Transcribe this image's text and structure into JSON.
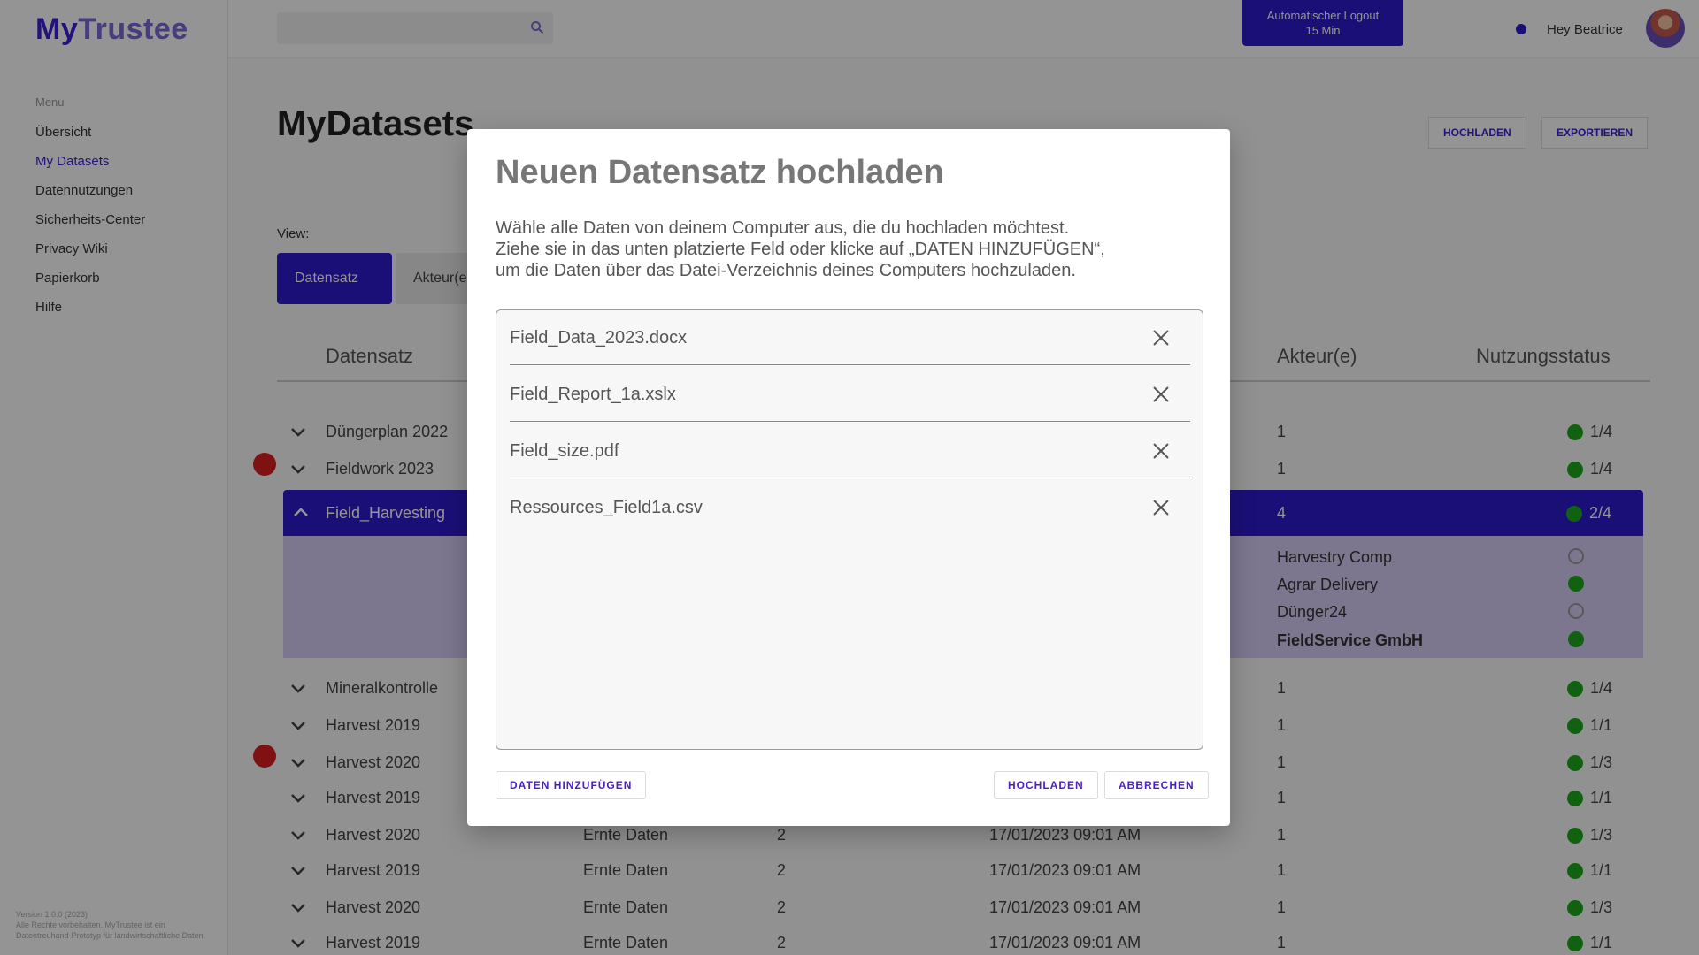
{
  "app": {
    "logo_my": "My",
    "logo_rest": "Trustee",
    "menu_label": "Menu",
    "sidebar": [
      "Übersicht",
      "My Datasets",
      "Datennutzungen",
      "Sicherheits-Center",
      "Privacy Wiki",
      "Papierkorb",
      "Hilfe"
    ],
    "footer_title": "Version 1.0.0 (2023)",
    "footer_text": "Alle Rechte vorbehalten. MyTrustee ist ein Datentreuhand-Prototyp für landwirtschaftliche Daten."
  },
  "topbar": {
    "logout_line1": "Automatischer Logout",
    "logout_line2": "15 Min",
    "greeting": "Hey Beatrice"
  },
  "page": {
    "title": "MyDatasets",
    "btn_upload": "HOCHLADEN",
    "btn_export": "EXPORTIEREN",
    "view_label": "View:",
    "tab_active": "Datensatz",
    "tab_inactive": "Akteur(e)"
  },
  "table": {
    "headers": {
      "dataset": "Datensatz",
      "actors": "Akteur(e)",
      "status": "Nutzungsstatus"
    },
    "rows": [
      {
        "name": "Düngerplan 2022",
        "type": "",
        "count": "",
        "date": "",
        "actors": "1",
        "status": "1/4"
      },
      {
        "name": "Fieldwork 2023",
        "type": "",
        "count": "",
        "date": "",
        "actors": "1",
        "status": "1/4"
      },
      {
        "name": "Field_Harvesting",
        "type": "",
        "count": "",
        "date": "",
        "actors": "4",
        "status": "2/4"
      },
      {
        "name": "Mineralkontrolle",
        "type": "",
        "count": "",
        "date": "",
        "actors": "1",
        "status": "1/4"
      },
      {
        "name": "Harvest 2019",
        "type": "",
        "count": "",
        "date": "",
        "actors": "1",
        "status": "1/1"
      },
      {
        "name": "Harvest 2020",
        "type": "",
        "count": "",
        "date": "",
        "actors": "1",
        "status": "1/3"
      },
      {
        "name": "Harvest 2019",
        "type": "",
        "count": "",
        "date": "",
        "actors": "1",
        "status": "1/1"
      },
      {
        "name": "Harvest 2020",
        "type": "Ernte Daten",
        "count": "2",
        "date": "17/01/2023 09:01 AM",
        "actors": "1",
        "status": "1/3"
      },
      {
        "name": "Harvest 2019",
        "type": "Ernte Daten",
        "count": "2",
        "date": "17/01/2023 09:01 AM",
        "actors": "1",
        "status": "1/1"
      },
      {
        "name": "Harvest 2020",
        "type": "Ernte Daten",
        "count": "2",
        "date": "17/01/2023 09:01 AM",
        "actors": "1",
        "status": "1/3"
      },
      {
        "name": "Harvest 2019",
        "type": "Ernte Daten",
        "count": "2",
        "date": "17/01/2023 09:01 AM",
        "actors": "1",
        "status": "1/1"
      }
    ],
    "expanded_actors": [
      "Harvestry Comp",
      "Agrar Delivery",
      "Dünger24",
      "FieldService GmbH"
    ]
  },
  "modal": {
    "title": "Neuen Datensatz hochladen",
    "desc_line1": "Wähle alle Daten von deinem Computer aus, die du hochladen möchtest.",
    "desc_line2": "Ziehe sie in das unten platzierte Feld oder klicke auf „DATEN HINZUFÜGEN“,",
    "desc_line3": "um die Daten über das Datei-Verzeichnis deines Computers hochzuladen.",
    "files": [
      "Field_Data_2023.docx",
      "Field_Report_1a.xslx",
      "Field_size.pdf",
      "Ressources_Field1a.csv"
    ],
    "btn_add": "DATEN HINZUFÜGEN",
    "btn_upload": "HOCHLADEN",
    "btn_cancel": "ABBRECHEN"
  },
  "colors": {
    "primary": "#2d1bcc",
    "accent_text": "#4b20c2",
    "status_green": "#1ca91c",
    "alert_red": "#d91f1f"
  }
}
